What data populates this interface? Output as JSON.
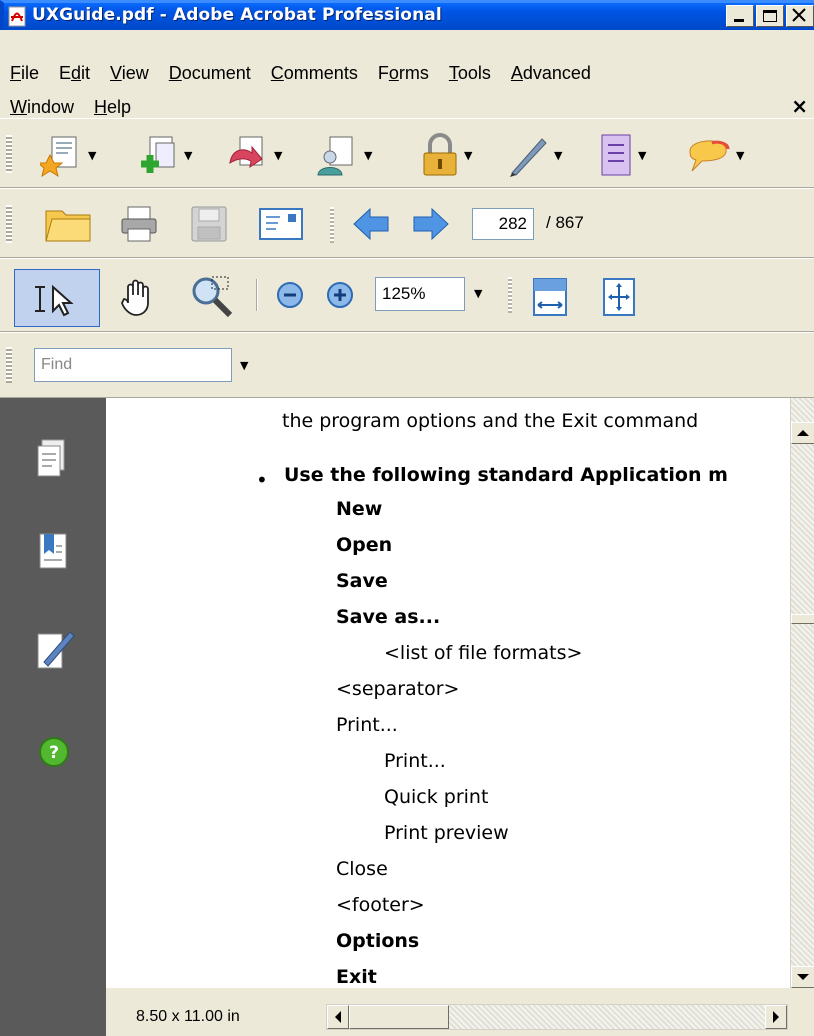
{
  "window": {
    "title": "UXGuide.pdf - Adobe Acrobat Professional",
    "controls": [
      "minimize",
      "maximize",
      "close"
    ]
  },
  "menu": {
    "row1": [
      {
        "pre": "",
        "u": "F",
        "post": "ile"
      },
      {
        "pre": "E",
        "u": "d",
        "post": "it"
      },
      {
        "pre": "",
        "u": "V",
        "post": "iew"
      },
      {
        "pre": "",
        "u": "D",
        "post": "ocument"
      },
      {
        "pre": "",
        "u": "C",
        "post": "omments"
      },
      {
        "pre": "F",
        "u": "o",
        "post": "rms"
      },
      {
        "pre": "",
        "u": "T",
        "post": "ools"
      },
      {
        "pre": "",
        "u": "A",
        "post": "dvanced"
      }
    ],
    "row2": [
      {
        "pre": "",
        "u": "W",
        "post": "indow"
      },
      {
        "pre": "",
        "u": "H",
        "post": "elp"
      }
    ],
    "close_glyph": "×"
  },
  "toolbar1": {
    "tools": [
      "create-pdf-icon",
      "combine-files-icon",
      "export-icon",
      "start-meeting-icon",
      "secure-icon",
      "sign-icon",
      "forms-icon",
      "review-comment-icon"
    ]
  },
  "toolbar2": {
    "current_page": "282",
    "total_pages": "/ 867"
  },
  "toolbar3": {
    "zoom": "125%"
  },
  "find": {
    "placeholder": "Find"
  },
  "document": {
    "lines": [
      {
        "text": "the program options and the Exit command",
        "bold": false
      },
      {
        "text": "Use the following standard Application m",
        "bold": true
      },
      {
        "text": "New",
        "bold": true
      },
      {
        "text": "Open",
        "bold": true
      },
      {
        "text": "Save",
        "bold": true
      },
      {
        "text": "Save as...",
        "bold": true
      },
      {
        "text": "<list of file formats>",
        "bold": false
      },
      {
        "text": "<separator>",
        "bold": false
      },
      {
        "text": "Print...",
        "bold": false
      },
      {
        "text": "Print...",
        "bold": false
      },
      {
        "text": "Quick print",
        "bold": false
      },
      {
        "text": "Print preview",
        "bold": false
      },
      {
        "text": "Close",
        "bold": false
      },
      {
        "text": "<footer>",
        "bold": false
      },
      {
        "text": "Options",
        "bold": true
      },
      {
        "text": "Exit",
        "bold": true
      }
    ],
    "bullet": "•"
  },
  "status": {
    "page_size": "8.50 x 11.00 in"
  },
  "sidebar": {
    "icons": [
      "pages-icon",
      "bookmarks-icon",
      "signatures-icon",
      "help-icon"
    ]
  }
}
